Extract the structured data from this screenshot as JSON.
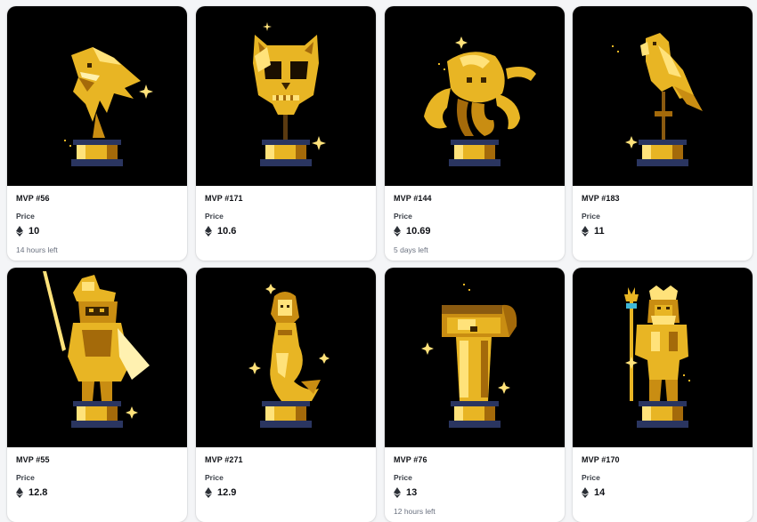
{
  "colors": {
    "accent": "#e8b524",
    "gold_dark": "#a46a0a",
    "gold_light": "#ffe27a",
    "pedestal_blue": "#2a3560",
    "background": "#000000"
  },
  "price_label": "Price",
  "currency_icon": "ethereum-icon",
  "items": [
    {
      "title": "MVP #56",
      "price": "10",
      "time_left": "14 hours left",
      "subject": "shark"
    },
    {
      "title": "MVP #171",
      "price": "10.6",
      "time_left": "",
      "subject": "cat-skull"
    },
    {
      "title": "MVP #144",
      "price": "10.69",
      "time_left": "5 days left",
      "subject": "octopus"
    },
    {
      "title": "MVP #183",
      "price": "11",
      "time_left": "",
      "subject": "parrot"
    },
    {
      "title": "MVP #55",
      "price": "12.8",
      "time_left": "",
      "subject": "pirate"
    },
    {
      "title": "MVP #271",
      "price": "12.9",
      "time_left": "",
      "subject": "mermaid"
    },
    {
      "title": "MVP #76",
      "price": "13",
      "time_left": "12 hours left",
      "subject": "treasure-chest"
    },
    {
      "title": "MVP #170",
      "price": "14",
      "time_left": "",
      "subject": "poseidon"
    }
  ]
}
